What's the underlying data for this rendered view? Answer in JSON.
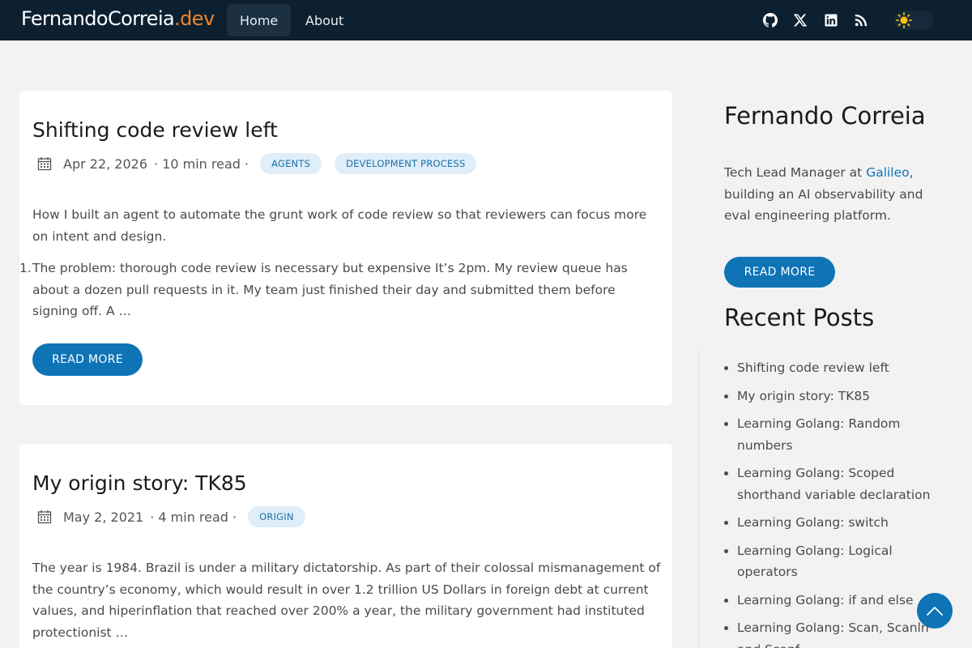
{
  "site": {
    "brand_name": "FernandoCorreia",
    "brand_tld": ".dev",
    "nav": [
      {
        "label": "Home",
        "active": true
      },
      {
        "label": "About",
        "active": false
      }
    ],
    "social_icons": [
      "github-icon",
      "x-icon",
      "linkedin-icon",
      "rss-icon"
    ],
    "theme_toggle_icon": "sun-icon"
  },
  "posts": [
    {
      "title": "Shifting code review left",
      "date": "Apr 22, 2026",
      "read_time": "· 10 min read ·",
      "tags": [
        "AGENTS",
        "DEVELOPMENT PROCESS"
      ],
      "intro": "How I built an agent to automate the grunt work of code review so that reviewers can focus more on intent and design.",
      "list_number": "1.",
      "list_text": "The problem: thorough code review is necessary but expensive It’s 2pm. My review queue has about a dozen pull requests in it. My team just finished their day and submitted them before signing off. A …",
      "read_more": "READ MORE"
    },
    {
      "title": "My origin story: TK85",
      "date": "May 2, 2021",
      "read_time": "· 4 min read ·",
      "tags": [
        "ORIGIN"
      ],
      "intro": "The year is 1984. Brazil is under a military dictatorship. As part of their colossal mismanagement of the country’s economy, which would result in over 1.2 trillion US Dollars in foreign debt at current values, and hiperinflation that reached over 200% a year, the military government had instituted protectionist …"
    }
  ],
  "sidebar": {
    "name": "Fernando Correia",
    "bio_prefix": "Tech Lead Manager at ",
    "bio_link": "Galileo",
    "bio_suffix": ", building an AI observability and eval engineering platform.",
    "read_more": "READ MORE",
    "recent_title": "Recent Posts",
    "recent_posts": [
      "Shifting code review left",
      "My origin story: TK85",
      "Learning Golang: Random numbers",
      "Learning Golang: Scoped shorthand variable declaration",
      "Learning Golang: switch",
      "Learning Golang: Logical operators",
      "Learning Golang: if and else",
      "Learning Golang: Scan, Scanln and Scanf"
    ]
  },
  "colors": {
    "navbar": "#0c2030",
    "accent": "#0e74b6",
    "brand_tld": "#f0842c",
    "tag_bg": "#dfeef8"
  }
}
